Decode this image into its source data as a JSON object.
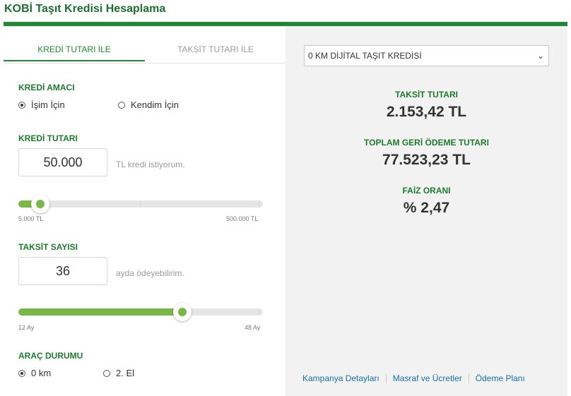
{
  "page": {
    "title": "KOBİ Taşıt Kredisi Hesaplama"
  },
  "colors": {
    "brand_green": "#1e8a33",
    "slider_green": "#7ab648",
    "link_blue": "#1a6fa8"
  },
  "tabs": [
    {
      "label": "KREDİ TUTARI İLE",
      "active": true
    },
    {
      "label": "TAKSİT TUTARI İLE",
      "active": false
    }
  ],
  "purpose": {
    "label": "KREDİ AMACI",
    "options": [
      {
        "label": "İşim İçin",
        "selected": true
      },
      {
        "label": "Kendim İçin",
        "selected": false
      }
    ]
  },
  "amount": {
    "label": "KREDİ TUTARI",
    "value": "50.000",
    "hint": "TL kredi istiyorum.",
    "min_label": "5.000 TL",
    "max_label": "500.000 TL",
    "slider_fraction": 0.09
  },
  "installments": {
    "label": "TAKSİT SAYISI",
    "value": "36",
    "hint": "ayda ödeyebilirim.",
    "min_label": "12 Ay",
    "max_label": "48 Ay",
    "slider_fraction": 0.67
  },
  "vehicle": {
    "label": "ARAÇ DURUMU",
    "options": [
      {
        "label": "0 km",
        "selected": true
      },
      {
        "label": "2. El",
        "selected": false
      }
    ]
  },
  "product_select": {
    "value": "0 KM DİJİTAL TAŞIT KREDİSİ",
    "icon": "chevron-down-icon"
  },
  "results": {
    "installment_label": "TAKSİT TUTARI",
    "installment_value": "2.153,42 TL",
    "total_label": "TOPLAM GERİ ÖDEME TUTARI",
    "total_value": "77.523,23 TL",
    "rate_label": "FAİZ ORANI",
    "rate_value": "% 2,47"
  },
  "links": [
    "Kampanya Detayları",
    "Masraf ve Ücretler",
    "Ödeme Planı"
  ]
}
